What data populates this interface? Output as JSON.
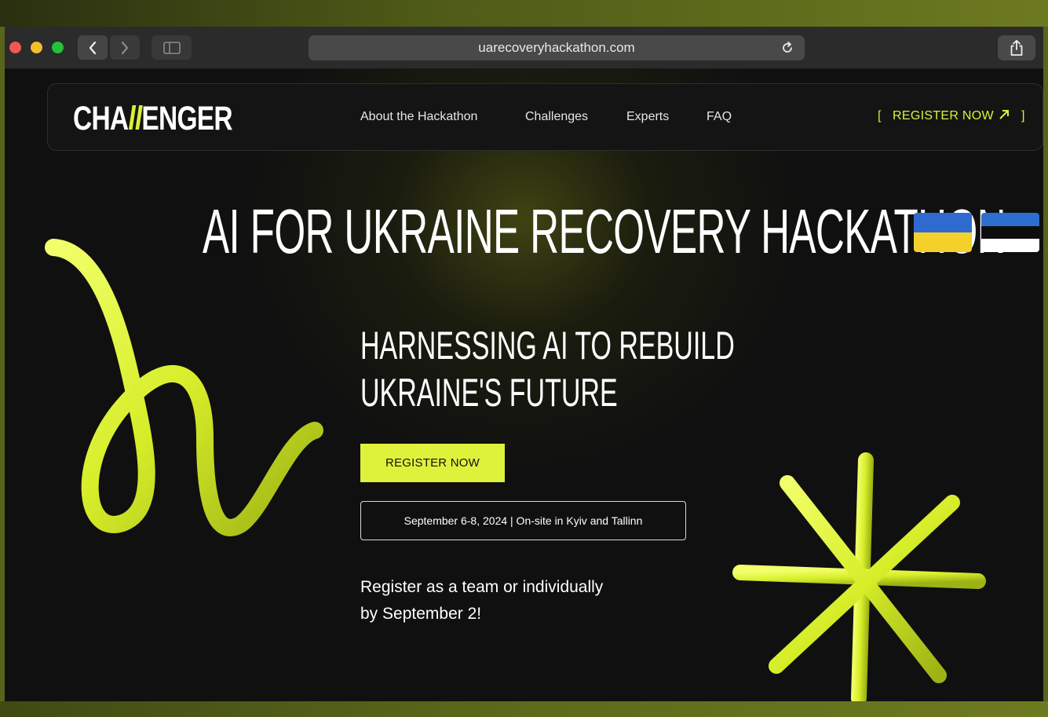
{
  "browser": {
    "url": "uarecoveryhackathon.com"
  },
  "site": {
    "logo": {
      "part1": "CHA",
      "part2": "ll",
      "part3": "ENGER"
    },
    "menu": [
      "About the Hackathon",
      "Challenges",
      "Experts",
      "FAQ"
    ],
    "nav_register": "REGISTER NOW",
    "nav_register_open": "[",
    "nav_register_close": "]"
  },
  "hero": {
    "title": "AI FOR UKRAINE RECOVERY HACKATHON",
    "subtitle_line1": "HARNESSING AI TO REBUILD",
    "subtitle_line2": "UKRAINE'S FUTURE",
    "cta": "REGISTER NOW",
    "date_info": "September 6-8, 2024 | On-site in Kyiv and Tallinn",
    "note_line1": "Register as a team or individually",
    "note_line2": "by September 2!"
  },
  "colors": {
    "accent": "#dff23b",
    "background": "#101010",
    "text": "#ffffff"
  },
  "icons": {
    "flags": [
      "ukraine-flag-icon",
      "estonia-flag-icon"
    ]
  }
}
